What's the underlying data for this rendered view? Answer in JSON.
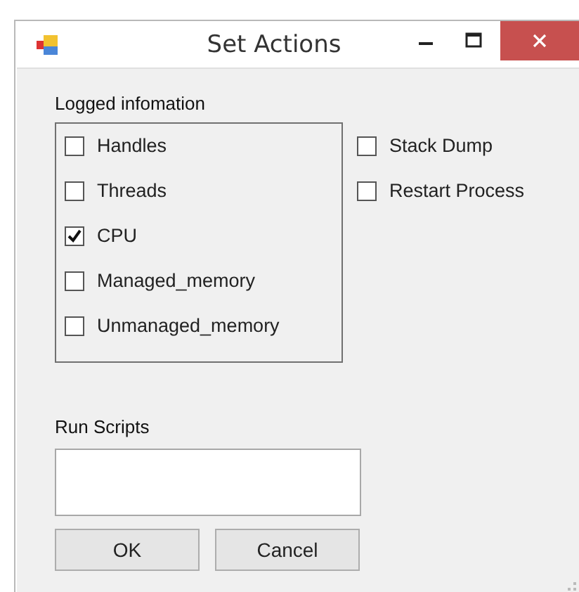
{
  "window": {
    "title": "Set Actions"
  },
  "logged_information": {
    "label": "Logged infomation",
    "options": [
      {
        "label": "Handles",
        "checked": false
      },
      {
        "label": "Threads",
        "checked": false
      },
      {
        "label": "CPU",
        "checked": true
      },
      {
        "label": "Managed_memory",
        "checked": false
      },
      {
        "label": "Unmanaged_memory",
        "checked": false
      }
    ]
  },
  "side_options": [
    {
      "label": "Stack Dump",
      "checked": false
    },
    {
      "label": "Restart Process",
      "checked": false
    }
  ],
  "run_scripts": {
    "label": "Run Scripts"
  },
  "buttons": [
    "OK",
    "Cancel"
  ]
}
